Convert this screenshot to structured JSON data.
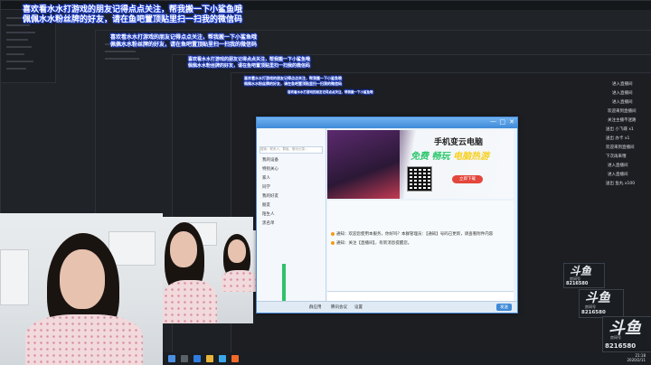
{
  "overlay": {
    "line1": "喜欢看水水打游戏的朋友记得点点关注，帮我搬一下小鲨鱼哦",
    "line2": "佩佩水水粉丝牌的好友，请在鱼吧置顶贴里扫一扫我的微信码"
  },
  "chat": {
    "title": "",
    "search_placeholder": "搜索：联系人、群组、聊天记录...",
    "groups": [
      {
        "label": "我的设备"
      },
      {
        "label": "特别关心"
      },
      {
        "label": "家人"
      },
      {
        "label": "同学"
      },
      {
        "label": "我的好友"
      },
      {
        "label": "朋友"
      },
      {
        "label": "陌生人"
      },
      {
        "label": "黑名单"
      }
    ],
    "banner_title": "手机变云电脑",
    "banner_sub_1": "免费",
    "banner_sub_2": "畅玩",
    "banner_sub_3": "电脑热游",
    "banner_button": "立即下载",
    "messages": [
      "通知：欢迎您使用本服务，你好吗？本群管理员：【通知】号码已更新，请查看附件内容",
      "通知：关注【直播间】，有新消息提醒您。"
    ],
    "bottom_items": [
      "群应用",
      "腾讯会议",
      "设置",
      "发送"
    ]
  },
  "stream": {
    "platform_logo": "斗鱼",
    "platform_sub": "房间号",
    "room_number": "8216580"
  },
  "right_log": [
    "进入直播间",
    "进入直播间",
    "进入直播间",
    "欢迎来到直播间",
    "关注主播不迷路",
    "送出 小飞碟 x1",
    "送出 办卡 x1",
    "欢迎来到直播间",
    "下次再来哦",
    "进入直播间",
    "进入直播间",
    "送出 鱼丸 x100"
  ],
  "taskbar": {
    "time": "21:18",
    "date": "2020/2/11"
  },
  "colors": {
    "overlay_glow": "#1b3fd6",
    "chat_title": "#3f8ad8",
    "banner_green": "#2cc86d",
    "banner_yellow": "#f6d01c"
  }
}
